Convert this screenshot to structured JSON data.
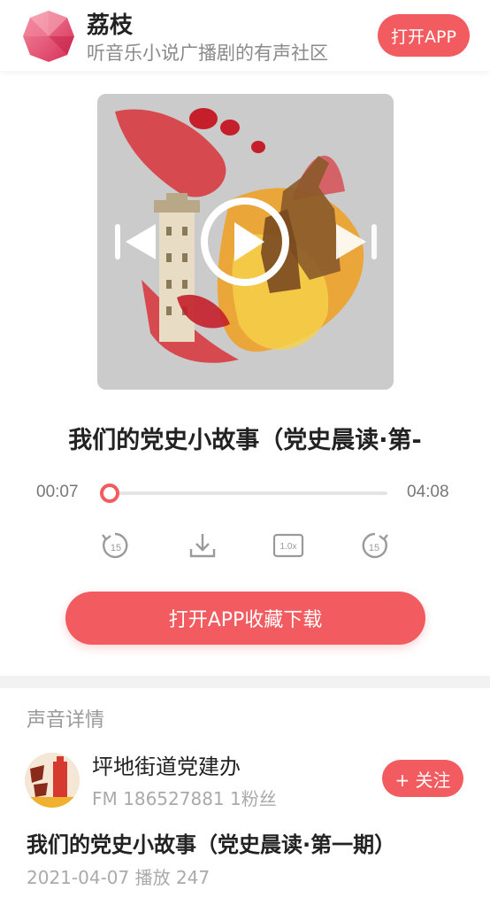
{
  "header": {
    "app_name": "荔枝",
    "slogan": "听音乐小说广播剧的有声社区",
    "open_app_label": "打开APP"
  },
  "player": {
    "title": "我们的党史小故事（党史晨读·第-",
    "current_time": "00:07",
    "total_time": "04:08",
    "progress": 0.03,
    "rewind_label": "15",
    "forward_label": "15",
    "speed_label": "1.0x",
    "big_button_label": "打开APP收藏下载"
  },
  "details": {
    "section_label": "声音详情",
    "author_name": "坪地街道党建办",
    "author_meta": "FM 186527881 1粉丝",
    "follow_label": "+ 关注",
    "episode_title": "我们的党史小故事（党史晨读·第一期）",
    "episode_meta": "2021-04-07 播放 247"
  },
  "colors": {
    "accent": "#f25b5f",
    "text": "#222222",
    "muted": "#aaaaaa"
  },
  "icons": [
    "lychee-logo-icon",
    "previous-icon",
    "play-icon",
    "next-icon",
    "rewind-15-icon",
    "download-icon",
    "speed-icon",
    "forward-15-icon"
  ]
}
